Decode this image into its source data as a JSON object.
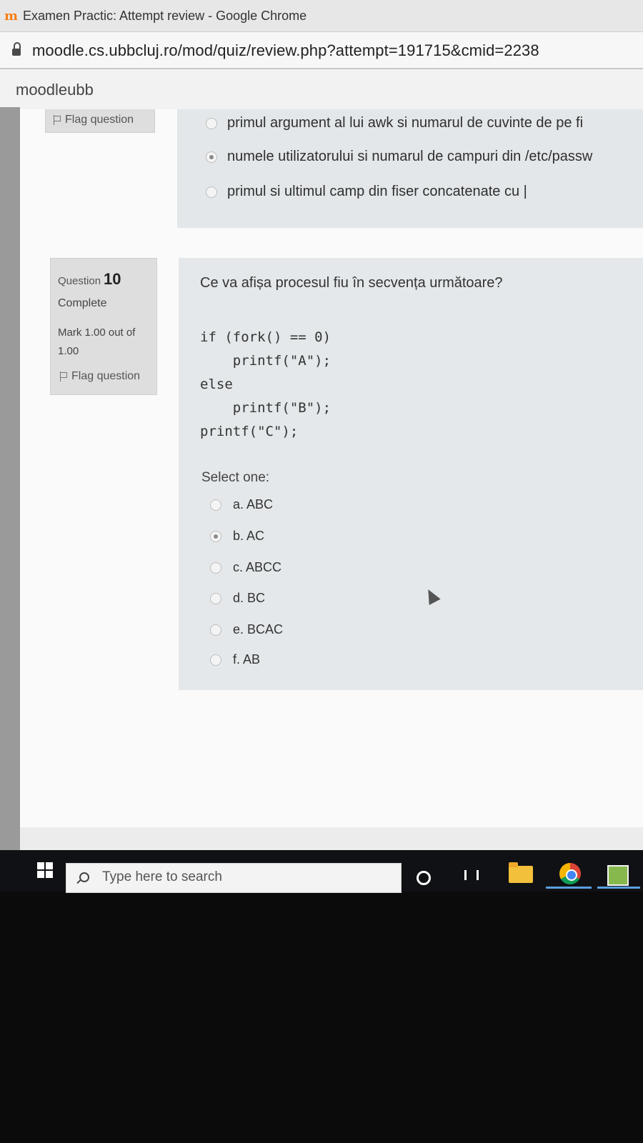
{
  "browser": {
    "window_title": "Examen Practic: Attempt review - Google Chrome",
    "url": "moodle.cs.ubbcluj.ro/mod/quiz/review.php?attempt=191715&cmid=2238",
    "site_name": "moodleubb"
  },
  "previous_question": {
    "flag_label": "Flag question",
    "options": [
      {
        "text": "primul argument al lui awk si numarul de cuvinte de pe fi",
        "selected": false
      },
      {
        "text": "numele utilizatorului si numarul de campuri din /etc/passw",
        "selected": true
      },
      {
        "text": "primul si ultimul camp din fiser concatenate cu |",
        "selected": false
      }
    ]
  },
  "question": {
    "label": "Question",
    "number": "10",
    "state": "Complete",
    "grade": "Mark 1.00 out of 1.00",
    "flag_label": "Flag question",
    "text": "Ce va afișa procesul fiu în secvența următoare?",
    "code_lines": [
      "if (fork() == 0)",
      "    printf(\"A\");",
      "else",
      "    printf(\"B\");",
      "printf(\"C\");"
    ],
    "prompt": "Select one:",
    "answers": [
      {
        "text": "a. ABC",
        "selected": false
      },
      {
        "text": "b. AC",
        "selected": true
      },
      {
        "text": "c. ABCC",
        "selected": false
      },
      {
        "text": "d. BC",
        "selected": false
      },
      {
        "text": "e. BCAC",
        "selected": false
      },
      {
        "text": "f. AB",
        "selected": false
      }
    ]
  },
  "taskbar": {
    "search_placeholder": "Type here to search",
    "icons": [
      "windows-start-icon",
      "cortana-icon",
      "task-view-icon",
      "file-explorer-icon",
      "chrome-icon",
      "app-icon"
    ]
  }
}
